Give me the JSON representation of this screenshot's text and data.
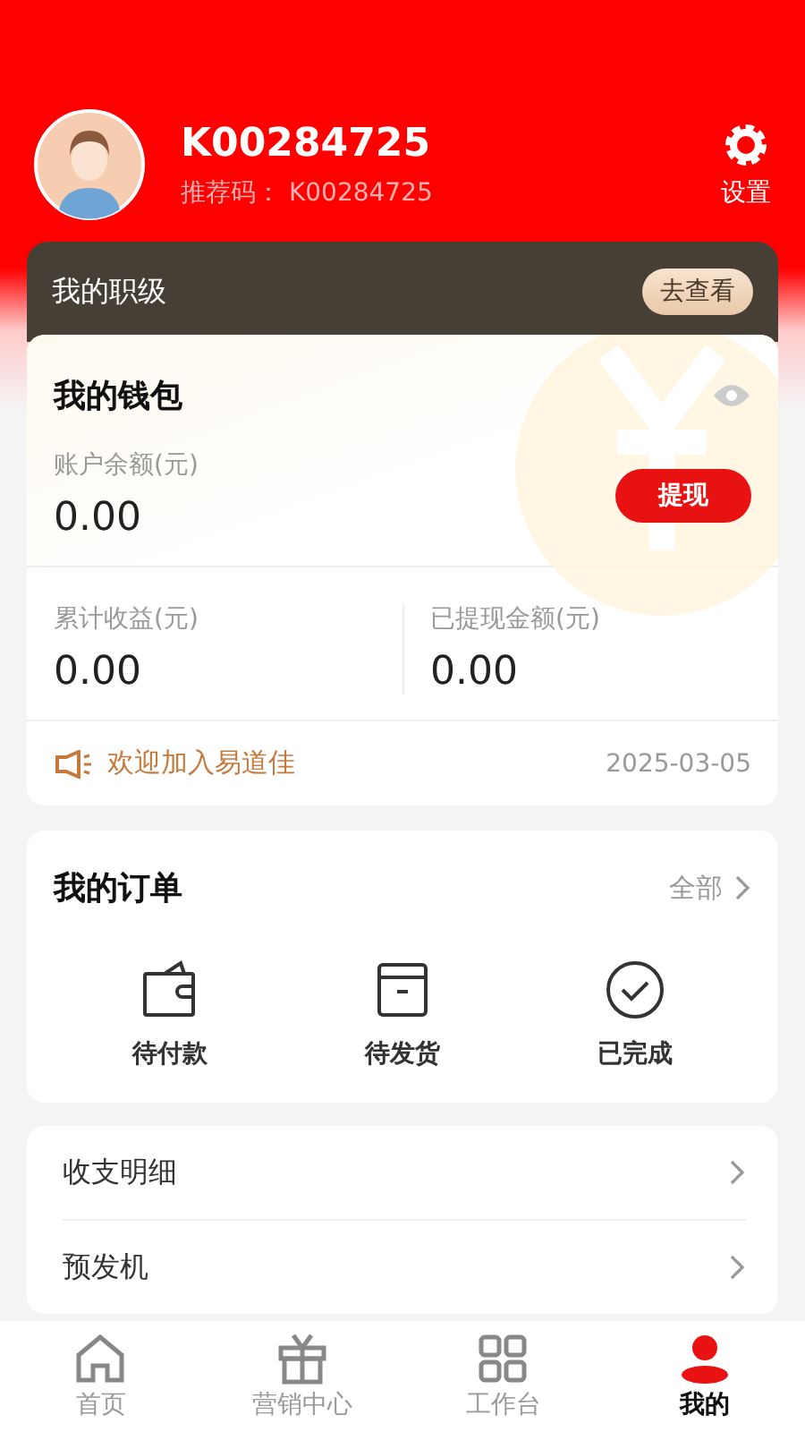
{
  "profile": {
    "name": "K00284725",
    "referral_label": "推荐码：",
    "referral_code": "K00284725",
    "settings_label": "设置"
  },
  "rank": {
    "title": "我的职级",
    "button": "去查看"
  },
  "wallet": {
    "title": "我的钱包",
    "balance_label": "账户余额(元)",
    "balance": "0.00",
    "withdraw_button": "提现",
    "stats": [
      {
        "label": "累计收益(元)",
        "value": "0.00"
      },
      {
        "label": "已提现金额(元)",
        "value": "0.00"
      }
    ],
    "notice": "欢迎加入易道佳",
    "notice_date": "2025-03-05"
  },
  "orders": {
    "title": "我的订单",
    "all_link": "全部",
    "items": [
      {
        "kind": "wallet",
        "label": "待付款"
      },
      {
        "kind": "box",
        "label": "待发货"
      },
      {
        "kind": "check",
        "label": "已完成"
      }
    ]
  },
  "menu": [
    "收支明细",
    "预发机"
  ],
  "tab_bar": [
    {
      "kind": "home",
      "label": "首页",
      "selected": false
    },
    {
      "kind": "gift",
      "label": "营销中心",
      "selected": false
    },
    {
      "kind": "grid",
      "label": "工作台",
      "selected": false
    },
    {
      "kind": "user",
      "label": "我的",
      "selected": true
    }
  ]
}
